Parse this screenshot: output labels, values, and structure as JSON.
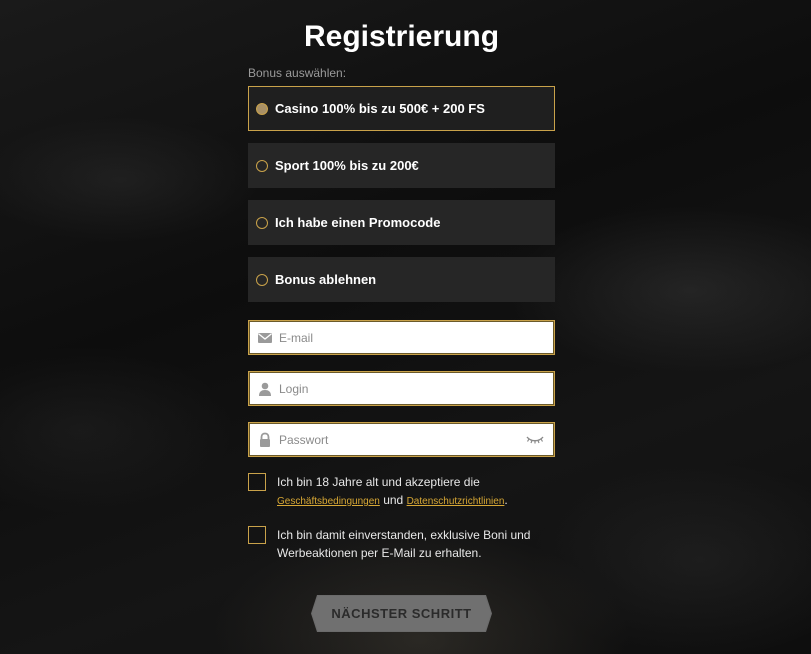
{
  "title": "Registrierung",
  "bonus_label": "Bonus auswählen:",
  "bonus_options": [
    {
      "label": "Casino 100% bis zu 500€ + 200 FS",
      "selected": true
    },
    {
      "label": "Sport 100% bis zu 200€",
      "selected": false
    },
    {
      "label": "Ich habe einen Promocode",
      "selected": false
    },
    {
      "label": "Bonus ablehnen",
      "selected": false
    }
  ],
  "fields": {
    "email": {
      "placeholder": "E-mail",
      "icon": "envelope-icon"
    },
    "login": {
      "placeholder": "Login",
      "icon": "user-icon"
    },
    "password": {
      "placeholder": "Passwort",
      "icon": "lock-icon",
      "toggle_icon": "eye-closed-icon"
    }
  },
  "consents": {
    "terms_prefix": "Ich bin 18 Jahre alt und akzeptiere die",
    "terms_link": "Geschäftsbedingungen",
    "terms_and": "und",
    "privacy_link": "Datenschutzrichtlinien",
    "terms_suffix": ".",
    "marketing": "Ich bin damit einverstanden, exklusive Boni und Werbeaktionen per E-Mail zu erhalten."
  },
  "next_button": "NÄCHSTER SCHRITT",
  "colors": {
    "accent": "#c9a24a",
    "link": "#d8a835",
    "background": "#121212",
    "option_bg": "#262626",
    "button": "#707070"
  }
}
